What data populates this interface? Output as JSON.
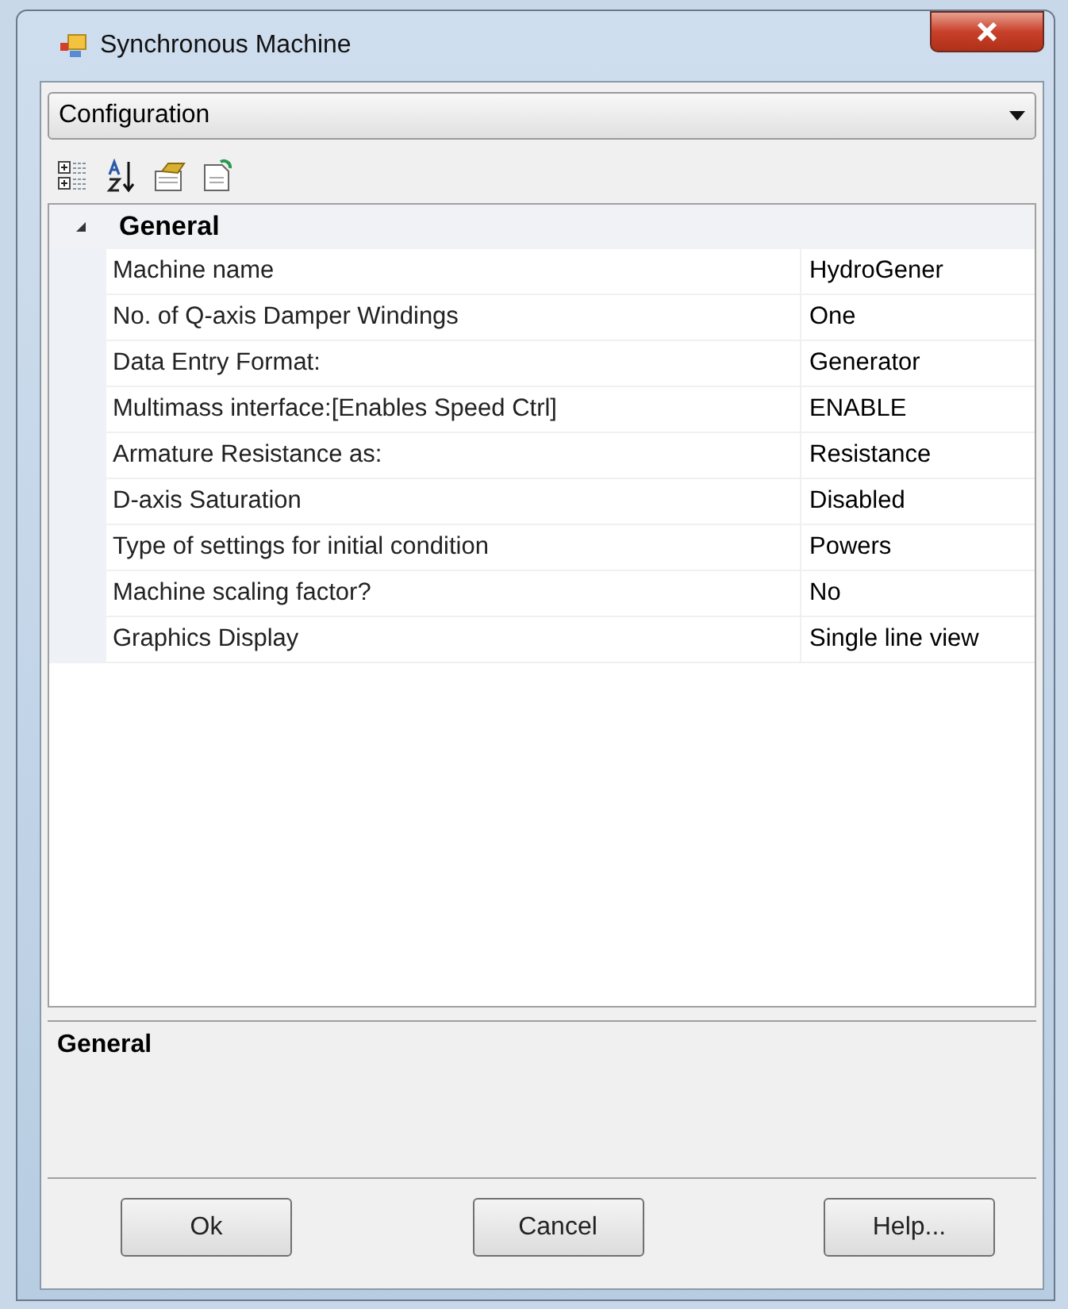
{
  "window": {
    "title": "Synchronous Machine"
  },
  "object_selector": {
    "value": "Configuration"
  },
  "category": {
    "name": "General",
    "expanded": true,
    "properties": [
      {
        "name": "Machine name",
        "value": "HydroGener"
      },
      {
        "name": "No. of Q-axis Damper Windings",
        "value": "One"
      },
      {
        "name": "Data Entry Format:",
        "value": "Generator"
      },
      {
        "name": "Multimass interface:[Enables Speed Ctrl]",
        "value": "ENABLE"
      },
      {
        "name": "Armature Resistance as:",
        "value": "Resistance"
      },
      {
        "name": "D-axis Saturation",
        "value": "Disabled"
      },
      {
        "name": "Type of settings for initial condition",
        "value": "Powers"
      },
      {
        "name": "Machine scaling factor?",
        "value": "No"
      },
      {
        "name": "Graphics Display",
        "value": "Single line view"
      }
    ]
  },
  "description": {
    "title": "General"
  },
  "buttons": [
    "Ok",
    "Cancel",
    "Help..."
  ]
}
